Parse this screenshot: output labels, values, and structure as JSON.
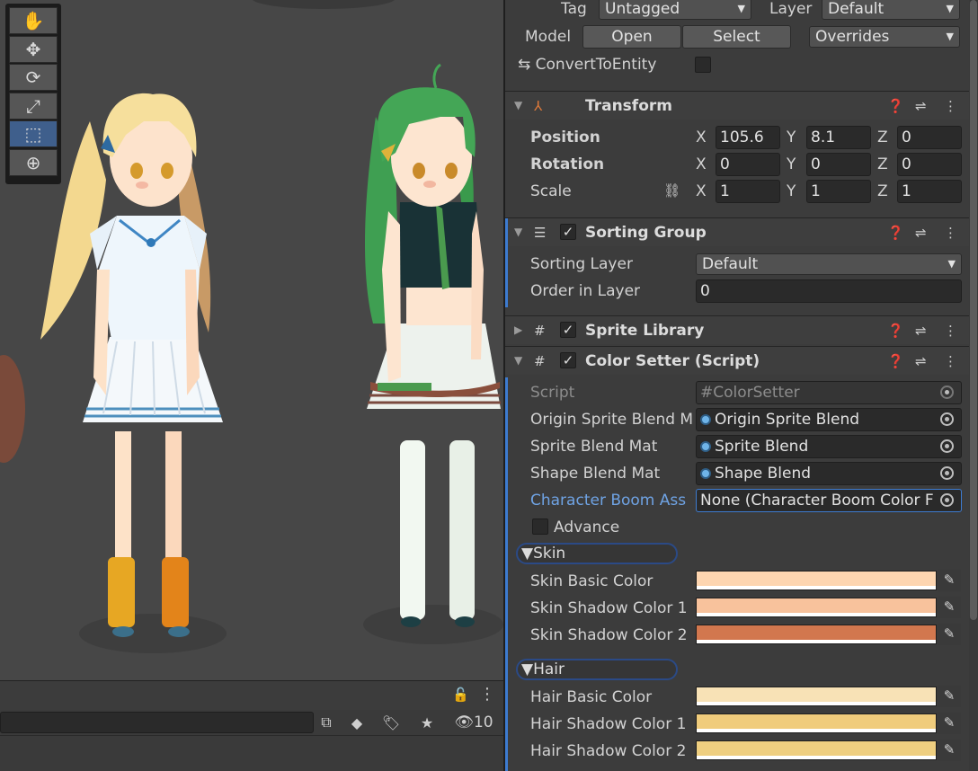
{
  "scene": {
    "tools": [
      {
        "name": "hand-tool",
        "glyph": "✋"
      },
      {
        "name": "move-tool",
        "glyph": "✥"
      },
      {
        "name": "rotate-tool",
        "glyph": "⟳"
      },
      {
        "name": "scale-tool",
        "glyph": "⤢"
      },
      {
        "name": "rect-tool",
        "glyph": "⬚"
      },
      {
        "name": "transform-tool",
        "glyph": "⊕"
      }
    ]
  },
  "bottom": {
    "hidden_count": "10"
  },
  "inspector": {
    "tag_label": "Tag",
    "tag_value": "Untagged",
    "layer_label": "Layer",
    "layer_value": "Default",
    "model_label": "Model",
    "open_label": "Open",
    "select_label": "Select",
    "overrides_label": "Overrides",
    "convert_label": "ConvertToEntity",
    "transform": {
      "title": "Transform",
      "position_label": "Position",
      "rotation_label": "Rotation",
      "scale_label": "Scale",
      "x": "X",
      "y": "Y",
      "z": "Z",
      "position": [
        "105.6",
        "8.1",
        "0"
      ],
      "rotation": [
        "0",
        "0",
        "0"
      ],
      "scale": [
        "1",
        "1",
        "1"
      ]
    },
    "sorting_group": {
      "title": "Sorting Group",
      "sorting_layer_label": "Sorting Layer",
      "sorting_layer_value": "Default",
      "order_label": "Order in Layer",
      "order_value": "0"
    },
    "sprite_library": {
      "title": "Sprite Library"
    },
    "color_setter": {
      "title": "Color Setter (Script)",
      "script_label": "Script",
      "script_value": "ColorSetter",
      "origin_label": "Origin Sprite Blend M",
      "origin_value": "Origin Sprite Blend",
      "sprite_blend_label": "Sprite Blend Mat",
      "sprite_blend_value": "Sprite Blend",
      "shape_blend_label": "Shape Blend Mat",
      "shape_blend_value": "Shape Blend",
      "boom_label": "Character Boom Ass",
      "boom_value": "None (Character Boom Color F",
      "advance_label": "Advance",
      "skin_fold": "Skin",
      "skin_basic_label": "Skin Basic Color",
      "skin_shadow1_label": "Skin Shadow Color 1",
      "skin_shadow2_label": "Skin Shadow Color 2",
      "hair_fold": "Hair",
      "hair_basic_label": "Hair Basic Color",
      "hair_shadow1_label": "Hair Shadow Color 1",
      "hair_shadow2_label": "Hair Shadow Color 2",
      "colors": {
        "skin_basic": "#fdd5b0",
        "skin_shadow1": "#f8c29c",
        "skin_shadow2": "#d2774e",
        "hair_basic": "#f8e2b6",
        "hair_shadow1": "#f0cc7c",
        "hair_shadow2": "#efcf80"
      }
    }
  }
}
